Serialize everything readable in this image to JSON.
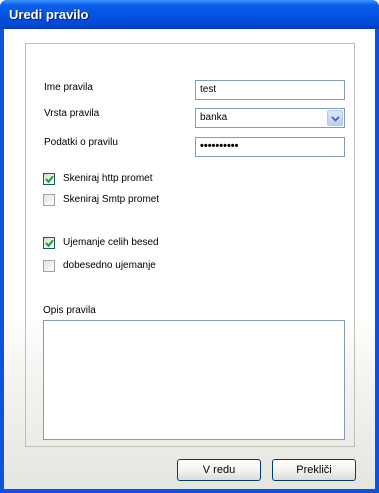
{
  "window": {
    "title": "Uredi pravilo"
  },
  "form": {
    "rule_name_label": "Ime pravila",
    "rule_name_value": "test",
    "rule_type_label": "Vrsta pravila",
    "rule_type_value": "banka",
    "rule_data_label": "Podatki o pravilu",
    "rule_data_value": "••••••••••",
    "scan_http_label": "Skeniraj http promet",
    "scan_http_checked": true,
    "scan_smtp_label": "Skeniraj Smtp promet",
    "scan_smtp_checked": false,
    "whole_words_label": "Ujemanje celih besed",
    "whole_words_checked": true,
    "exact_match_label": "dobesedno ujemanje",
    "exact_match_checked": false,
    "description_label": "Opis pravila",
    "description_value": ""
  },
  "buttons": {
    "ok_label": "V redu",
    "cancel_label": "Prekliči"
  },
  "colors": {
    "titlebar": "#0554e3",
    "input_border": "#7f9db9",
    "check": "#21a121"
  }
}
